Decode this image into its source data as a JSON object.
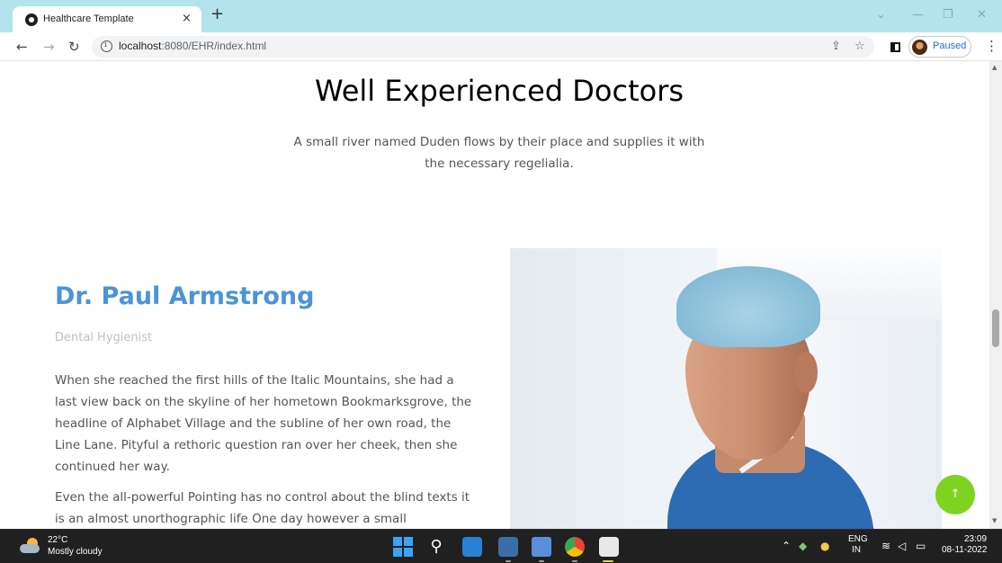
{
  "browser": {
    "tab_title": "Healthcare Template",
    "tab_close": "×",
    "new_tab": "+",
    "url_host": "localhost",
    "url_path": ":8080/EHR/index.html",
    "profile_status": "Paused"
  },
  "page": {
    "heading": "Well Experienced Doctors",
    "subheading": "A small river named Duden flows by their place and supplies it with the necessary regelialia.",
    "doctor": {
      "name": "Dr. Paul Armstrong",
      "role": "Dental Hygienist",
      "bio": [
        "When she reached the first hills of the Italic Mountains, she had a last view back on the skyline of her hometown Bookmarksgrove, the headline of Alphabet Village and the subline of her own road, the Line Lane. Pityful a rethoric question ran over her cheek, then she continued her way.",
        "Even the all-powerful Pointing has no control about the blind texts it is an almost unorthographic life One day however a small"
      ]
    },
    "back_to_top": "↑"
  },
  "taskbar": {
    "weather_temp": "22°C",
    "weather_desc": "Mostly cloudy",
    "lang_top": "ENG",
    "lang_bottom": "IN",
    "time": "23:09",
    "date": "08-11-2022"
  },
  "colors": {
    "title_bar": "#b3e3ec",
    "doctor_name": "#4b94d9",
    "back_to_top": "#7ed321",
    "taskbar": "#202020"
  }
}
